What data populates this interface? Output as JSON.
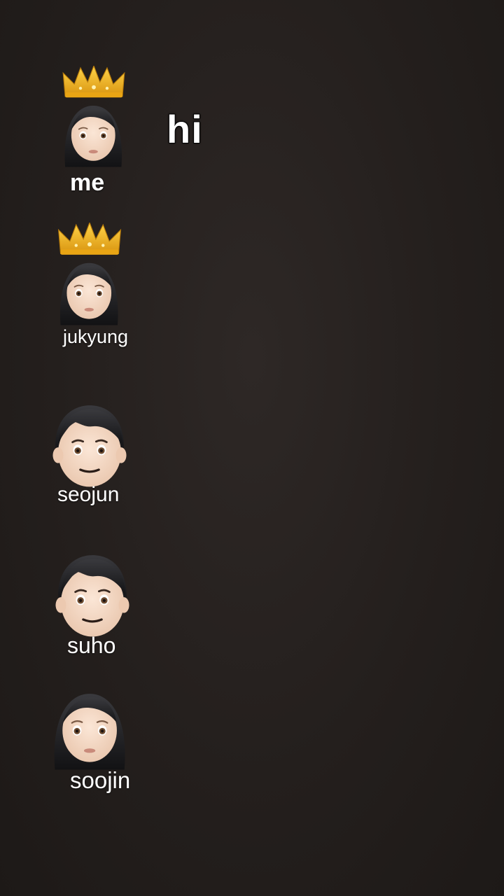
{
  "speech": {
    "text": "hi"
  },
  "characters": [
    {
      "name": "me",
      "emoji": "woman-with-crown-icon"
    },
    {
      "name": "jukyung",
      "emoji": "woman-with-crown-icon"
    },
    {
      "name": "seojun",
      "emoji": "boy-face-icon"
    },
    {
      "name": "suho",
      "emoji": "boy-face-icon"
    },
    {
      "name": "soojin",
      "emoji": "woman-face-icon"
    }
  ],
  "colors": {
    "background": "#241f1d",
    "text": "#ffffff",
    "hair": "#1b1b1d",
    "skin": "#f4d9c4",
    "crown": "#f2b41c"
  }
}
